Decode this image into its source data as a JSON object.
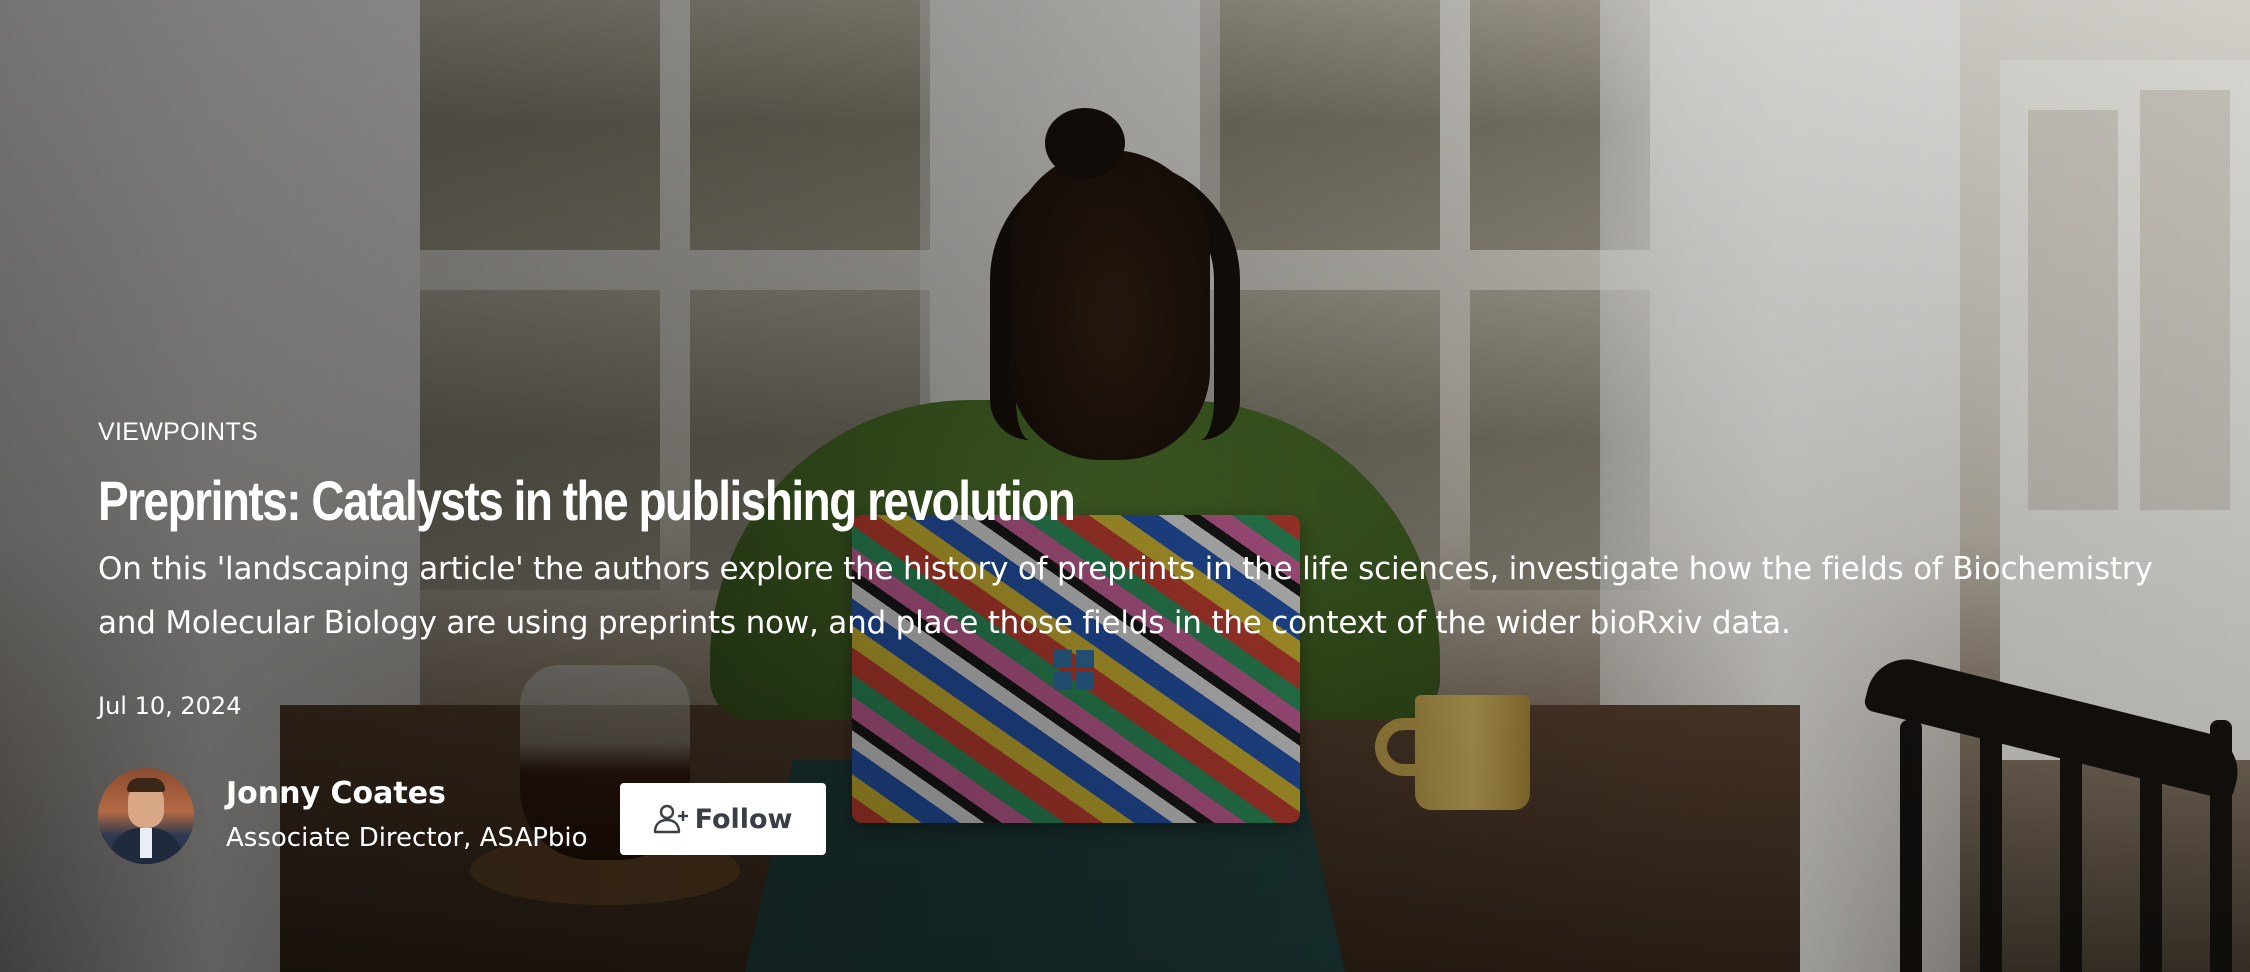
{
  "hero": {
    "kicker": "VIEWPOINTS",
    "title": "Preprints: Catalysts in the publishing revolution",
    "description": "On this 'landscaping article' the authors explore the history of preprints in the life sciences, investigate how the fields of Biochemistry and Molecular Biology are using preprints now, and place those fields in the context of the wider bioRxiv data.",
    "date": "Jul 10, 2024"
  },
  "author": {
    "name": "Jonny Coates",
    "role": "Associate Director, ASAPbio",
    "avatar_icon": "author-portrait"
  },
  "follow_button": {
    "label": "Follow",
    "icon": "add-user-icon"
  },
  "colors": {
    "text": "#ffffff",
    "button_bg": "#ffffff",
    "button_text": "#3a3f47"
  }
}
